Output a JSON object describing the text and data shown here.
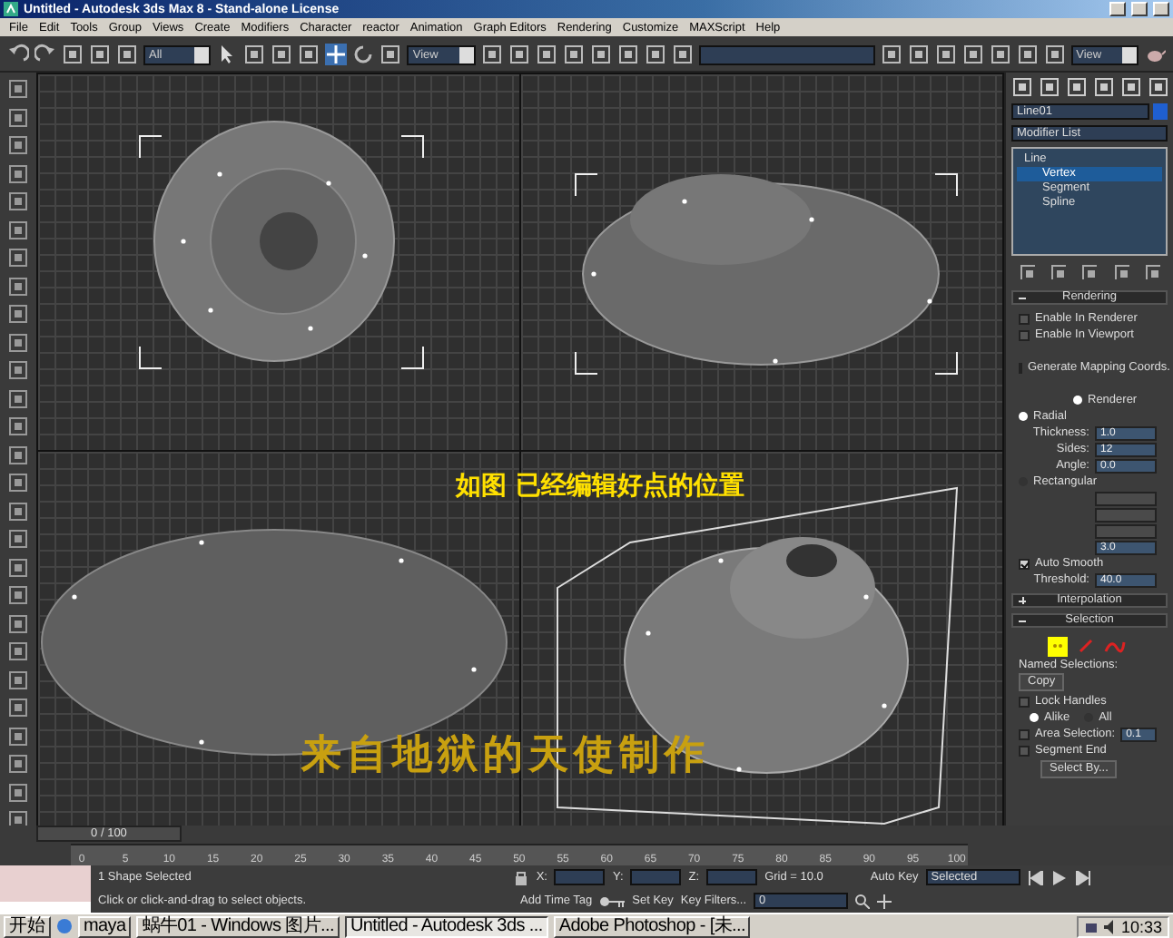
{
  "window": {
    "title": "Untitled - Autodesk 3ds Max 8  - Stand-alone License"
  },
  "menu": [
    "File",
    "Edit",
    "Tools",
    "Group",
    "Views",
    "Create",
    "Modifiers",
    "Character",
    "reactor",
    "Animation",
    "Graph Editors",
    "Rendering",
    "Customize",
    "MAXScript",
    "Help"
  ],
  "toolbar": {
    "selection_filter": "All",
    "reference_coord": "View",
    "view_dropdown": "View"
  },
  "viewports": [
    {
      "kind": "top"
    },
    {
      "kind": "front"
    },
    {
      "kind": "left"
    },
    {
      "kind": "perspective"
    }
  ],
  "annotations": [
    {
      "kind": "caption",
      "text": "如图 已经编辑好点的位置"
    },
    {
      "kind": "credit",
      "text": "来自地狱的天使制作"
    }
  ],
  "command_panel": {
    "object_name": "Line01",
    "modifier_list": "Modifier List",
    "stack": [
      {
        "label": "Line",
        "selected": false,
        "children": [
          {
            "label": "Vertex",
            "selected": true
          },
          {
            "label": "Segment",
            "selected": false
          },
          {
            "label": "Spline",
            "selected": false
          }
        ]
      }
    ],
    "rendering": {
      "title": "Rendering",
      "expanded": true,
      "enable_in_renderer": {
        "label": "Enable In Renderer",
        "checked": false
      },
      "enable_in_viewport": {
        "label": "Enable In Viewport",
        "checked": false
      },
      "generate_mapping": {
        "label": "Generate Mapping Coords.",
        "checked": false
      },
      "renderer": {
        "label": "Renderer",
        "selected": true
      },
      "radial": {
        "label": "Radial",
        "selected": true
      },
      "radial_params": [
        {
          "label": "Thickness:",
          "value": "1.0"
        },
        {
          "label": "Sides:",
          "value": "12"
        },
        {
          "label": "Angle:",
          "value": "0.0"
        }
      ],
      "rectangular": {
        "label": "Rectangular",
        "selected": false
      },
      "rect_fields": [
        {
          "disabled": true
        },
        {
          "disabled": true
        },
        {
          "disabled": true
        },
        {
          "value": "3.0",
          "disabled": false
        }
      ],
      "auto_smooth": {
        "label": "Auto Smooth",
        "checked": true
      },
      "threshold": {
        "label": "Threshold:",
        "value": "40.0"
      }
    },
    "interpolation": {
      "title": "Interpolation",
      "expanded": false
    },
    "selection": {
      "title": "Selection",
      "expanded": true,
      "named_selections": "Named Selections:",
      "copy": "Copy",
      "lock_handles": {
        "label": "Lock Handles",
        "checked": false
      },
      "alike": {
        "label": "Alike",
        "selected": true
      },
      "all": {
        "label": "All",
        "selected": false
      },
      "area_selection": {
        "label": "Area Selection:",
        "checked": false,
        "value": "0.1"
      },
      "segment_end": {
        "label": "Segment End",
        "checked": false
      },
      "select_by": "Select By..."
    }
  },
  "timeline": {
    "frame": "0 / 100",
    "level": 0,
    "ticks": [
      "0",
      "5",
      "10",
      "15",
      "20",
      "25",
      "30",
      "35",
      "40",
      "45",
      "50",
      "55",
      "60",
      "65",
      "70",
      "75",
      "80",
      "85",
      "90",
      "95",
      "100"
    ]
  },
  "status": {
    "selection": "1 Shape Selected",
    "prompt": "Click or click-and-drag to select objects.",
    "x_label": "X:",
    "y_label": "Y:",
    "z_label": "Z:",
    "grid": "Grid = 10.0",
    "time_tag": "Add Time Tag",
    "auto_key": "Auto Key",
    "key_mode": "Selected",
    "set_key": "Set Key",
    "key_filters": "Key Filters...",
    "current_frame": "0"
  },
  "taskbar": {
    "start": "开始",
    "tasks": [
      {
        "label": "maya",
        "selected": false
      },
      {
        "label": "蜗牛01 - Windows 图片...",
        "selected": false
      },
      {
        "label": "Untitled - Autodesk 3ds ...",
        "selected": true
      },
      {
        "label": "Adobe Photoshop - [未...",
        "selected": false
      }
    ],
    "clock": "10:33"
  }
}
